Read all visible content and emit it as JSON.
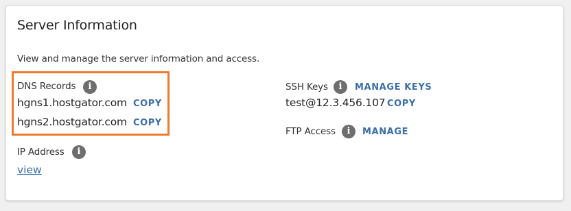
{
  "server_info": {
    "title": "Server Information",
    "description": "View and manage the server information and access."
  },
  "dns_records": {
    "label": "DNS Records",
    "entries": [
      {
        "value": "hgns1.hostgator.com",
        "action": "COPY"
      },
      {
        "value": "hgns2.hostgator.com",
        "action": "COPY"
      }
    ]
  },
  "ip_address": {
    "label": "IP Address",
    "link": "view"
  },
  "ssh_keys": {
    "label": "SSH Keys",
    "manage_action": "MANAGE KEYS",
    "value": "test@12.3.456.107",
    "copy_action": "COPY"
  },
  "ftp_access": {
    "label": "FTP Access",
    "manage_action": "MANAGE"
  },
  "icons": {
    "info": "info-icon",
    "info_glyph": "i"
  },
  "colors": {
    "accent": "#3a6ea5",
    "highlight": "#ee7a2d",
    "info_icon": "#6e6e6e"
  }
}
